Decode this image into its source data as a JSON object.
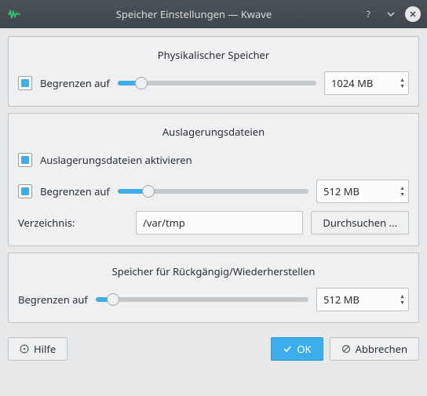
{
  "window": {
    "title": "Speicher Einstellungen — Kwave"
  },
  "physical": {
    "legend": "Physikalischer Speicher",
    "limit_label": "Begrenzen auf",
    "value": "1024 MB",
    "slider_percent": 12
  },
  "swap": {
    "legend": "Auslagerungsdateien",
    "enable_label": "Auslagerungsdateien aktivieren",
    "limit_label": "Begrenzen auf",
    "value": "512 MB",
    "slider_percent": 16,
    "dir_label": "Verzeichnis:",
    "dir_value": "/var/tmp",
    "browse_label": "Durchsuchen ..."
  },
  "undo": {
    "legend": "Speicher für Rückgängig/Wiederherstellen",
    "limit_label": "Begrenzen auf",
    "value": "512 MB",
    "slider_percent": 8
  },
  "buttons": {
    "help": "Hilfe",
    "ok": "OK",
    "cancel": "Abbrechen"
  }
}
